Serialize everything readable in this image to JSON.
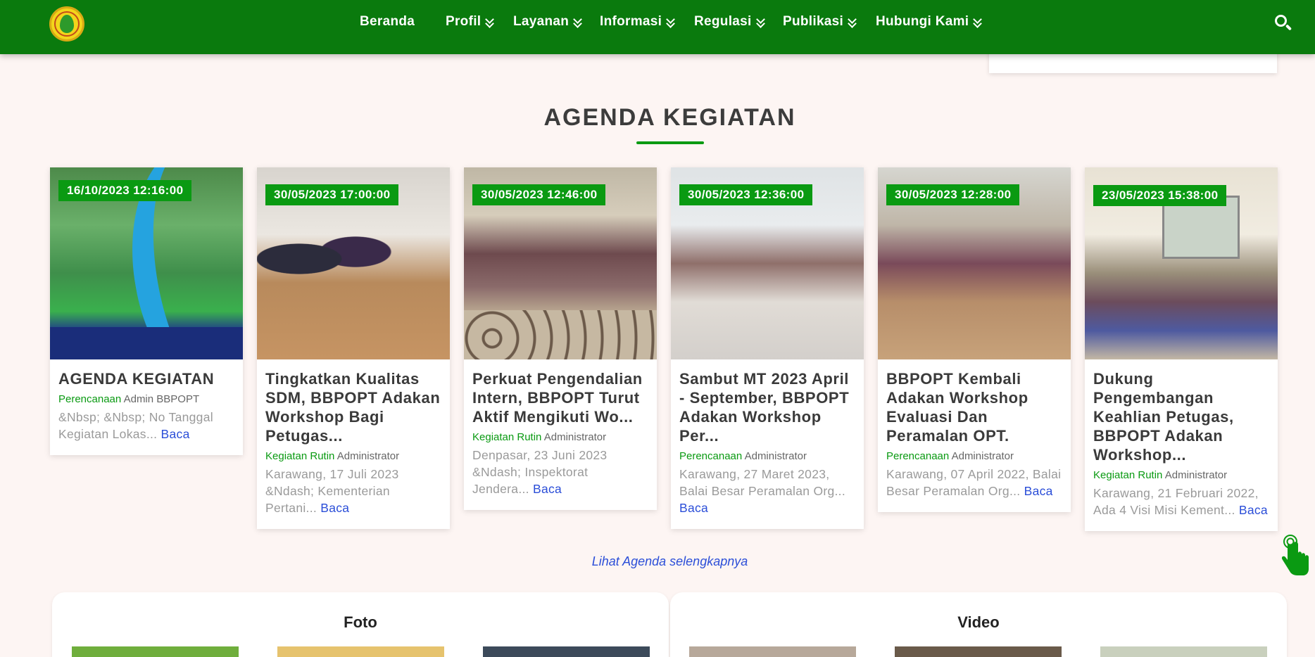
{
  "nav": {
    "items": [
      {
        "label": "Beranda",
        "dropdown": false
      },
      {
        "label": "Profil",
        "dropdown": true
      },
      {
        "label": "Layanan",
        "dropdown": true
      },
      {
        "label": "Informasi",
        "dropdown": true
      },
      {
        "label": "Regulasi",
        "dropdown": true
      },
      {
        "label": "Publikasi",
        "dropdown": true
      },
      {
        "label": "Hubungi Kami",
        "dropdown": true
      }
    ],
    "background": "#0a7a0d"
  },
  "section": {
    "title": "AGENDA KEGIATAN",
    "accent": "#0a9a12"
  },
  "cards": [
    {
      "date": "16/10/2023 12:16:00",
      "title": "AGENDA KEGIATAN",
      "category": "Perencanaan",
      "author": "Admin BBPOPT",
      "excerpt": "&Nbsp; &Nbsp; No Tanggal Kegiatan Lokas...",
      "read": "Baca"
    },
    {
      "date": "30/05/2023 17:00:00",
      "title": "Tingkatkan Kualitas SDM, BBPOPT Adakan Workshop Bagi Petugas...",
      "category": "Kegiatan Rutin",
      "author": "Administrator",
      "excerpt": "Karawang, 17 Juli 2023 &Ndash; Kementerian Pertani...",
      "read": "Baca"
    },
    {
      "date": "30/05/2023 12:46:00",
      "title": "Perkuat Pengendalian Intern, BBPOPT Turut Aktif Mengikuti Wo...",
      "category": "Kegiatan Rutin",
      "author": "Administrator",
      "excerpt": "Denpasar, 23 Juni 2023 &Ndash; Inspektorat Jendera...",
      "read": "Baca"
    },
    {
      "date": "30/05/2023 12:36:00",
      "title": "Sambut MT 2023 April - September, BBPOPT Adakan Workshop Per...",
      "category": "Perencanaan",
      "author": "Administrator",
      "excerpt": "Karawang, 27 Maret 2023, Balai Besar Peramalan Org...",
      "read": "Baca"
    },
    {
      "date": "30/05/2023 12:28:00",
      "title": "BBPOPT Kembali Adakan Workshop Evaluasi Dan Peramalan OPT.",
      "category": "Perencanaan",
      "author": "Administrator",
      "excerpt": "Karawang, 07 April 2022, Balai Besar Peramalan Org...",
      "read": "Baca"
    },
    {
      "date": "23/05/2023 15:38:00",
      "title": "Dukung Pengembangan Keahlian Petugas, BBPOPT Adakan Workshop...",
      "category": "Kegiatan Rutin",
      "author": "Administrator",
      "excerpt": "Karawang, 21 Februari 2022, Ada 4 Visi Misi Kement...",
      "read": "Baca"
    }
  ],
  "more_link": "Lihat Agenda selengkapnya",
  "panels": {
    "photo_title": "Foto",
    "video_title": "Video"
  },
  "icons": {
    "logo": "ministry-logo",
    "search": "search-icon",
    "pointer": "hand-pointer-icon"
  }
}
